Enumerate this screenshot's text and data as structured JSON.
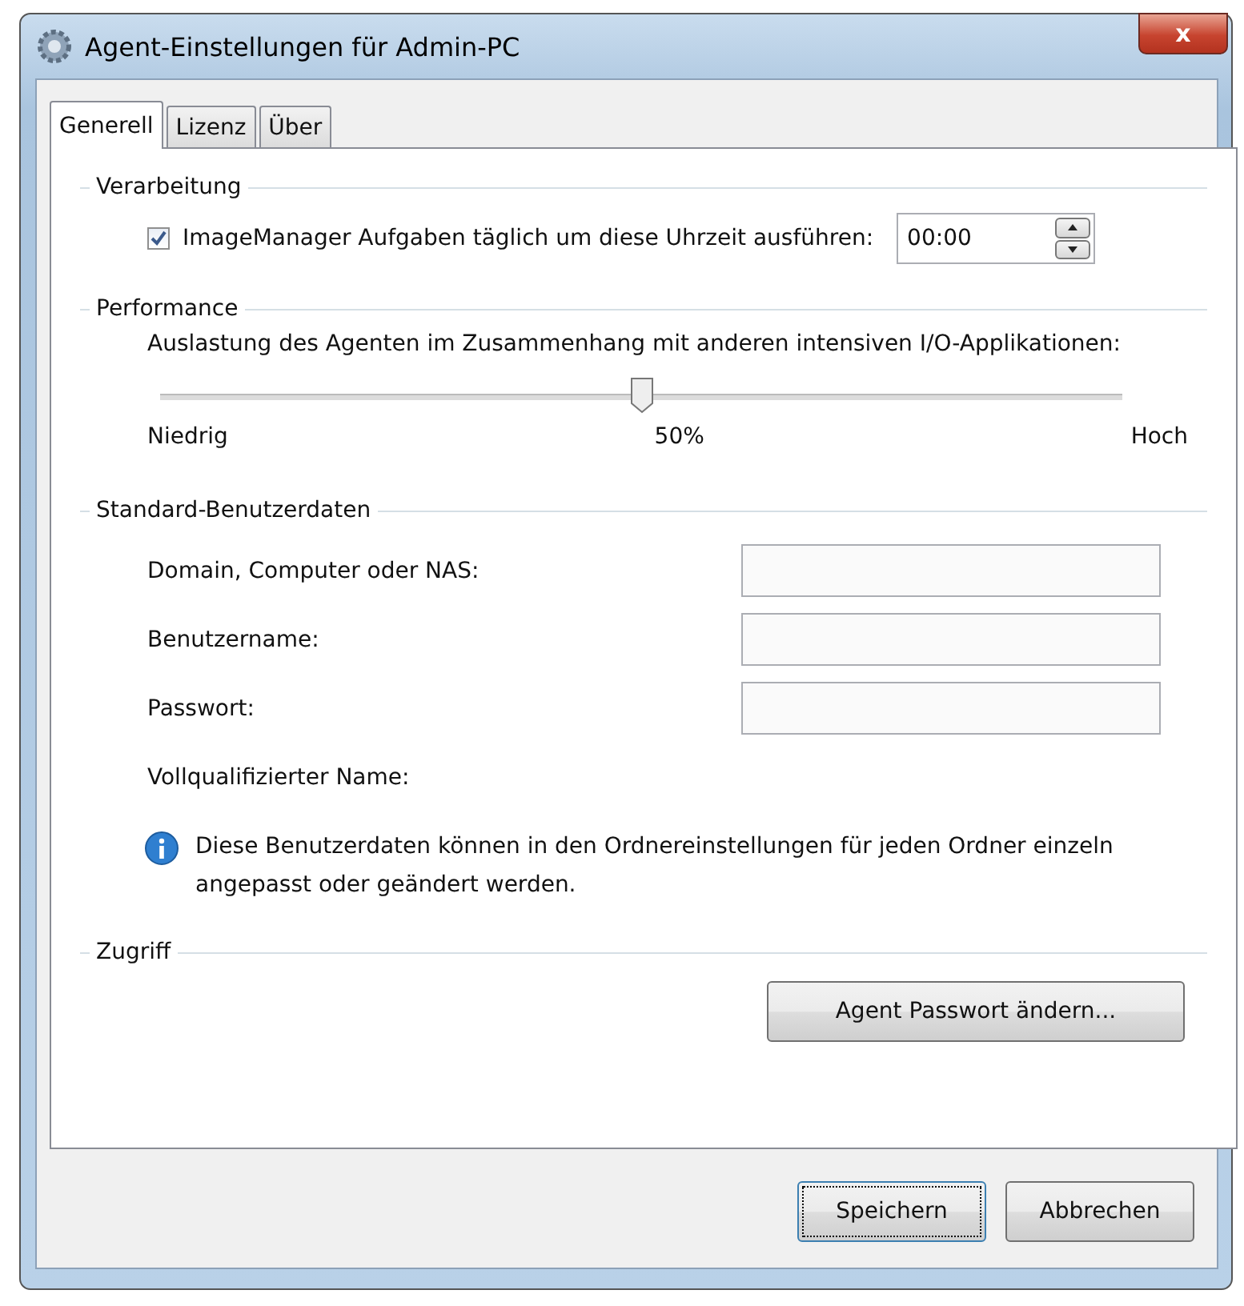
{
  "window": {
    "title": "Agent-Einstellungen für Admin-PC",
    "close": "x"
  },
  "tabs": [
    {
      "label": "Generell",
      "selected": true
    },
    {
      "label": "Lizenz",
      "selected": false
    },
    {
      "label": "Über",
      "selected": false
    }
  ],
  "processing": {
    "heading": "Verarbeitung",
    "checkbox": {
      "label": "ImageManager Aufgaben täglich um diese Uhrzeit ausführen:",
      "checked": true
    },
    "time": "00:00"
  },
  "performance": {
    "heading": "Performance",
    "description": "Auslastung des Agenten im Zusammenhang mit anderen intensiven I/O-Applikationen:",
    "slider": {
      "level": 0.5
    },
    "low_label": "Niedrig",
    "reading": "50%",
    "high_label": "Hoch"
  },
  "credentials": {
    "heading": "Standard-Benutzerdaten",
    "rows": [
      {
        "kind": "input",
        "label": "Domain, Computer oder NAS:"
      },
      {
        "kind": "input",
        "label": "Benutzername:"
      },
      {
        "kind": "input",
        "label": "Passwort:"
      },
      {
        "kind": "text",
        "label": "Vollqualifizierter Name:"
      }
    ],
    "info": "Diese Benutzerdaten können in den Ordnereinstellungen für jeden Ordner einzeln angepasst oder geändert werden."
  },
  "access": {
    "heading": "Zugriff",
    "button": "Agent Passwort ändern..."
  },
  "buttons": [
    {
      "label": "Speichern",
      "default": true
    },
    {
      "label": "Abbrechen",
      "default": false
    }
  ]
}
